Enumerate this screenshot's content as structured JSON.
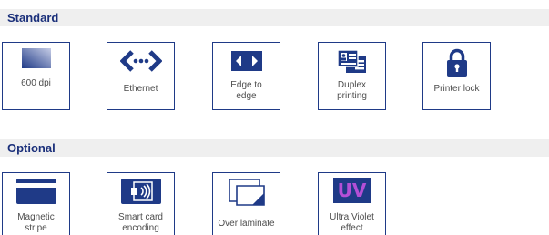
{
  "sections": {
    "standard": {
      "title": "Standard",
      "items": [
        {
          "label": "600 dpi",
          "icon": "gradient-card-icon"
        },
        {
          "label": "Ethernet",
          "icon": "network-arrows-icon"
        },
        {
          "label": "Edge to\nedge",
          "icon": "edge-arrows-icon"
        },
        {
          "label": "Duplex\nprinting",
          "icon": "duplex-cards-icon"
        },
        {
          "label": "Printer lock",
          "icon": "padlock-icon"
        }
      ]
    },
    "optional": {
      "title": "Optional",
      "items": [
        {
          "label": "Magnetic\nstripe",
          "icon": "magnetic-stripe-card-icon"
        },
        {
          "label": "Smart card\nencoding",
          "icon": "contactless-card-icon"
        },
        {
          "label": "Over laminate",
          "icon": "laminate-sheet-icon"
        },
        {
          "label": "Ultra Violet\neffect",
          "icon": "uv-icon",
          "icon_text": "UV"
        }
      ]
    }
  },
  "colors": {
    "brand_navy": "#1f3a87",
    "header_bg": "#efefef",
    "title_text": "#1a2f7a",
    "label_text": "#4d4d4d",
    "uv_purple": "#b44fd6"
  }
}
